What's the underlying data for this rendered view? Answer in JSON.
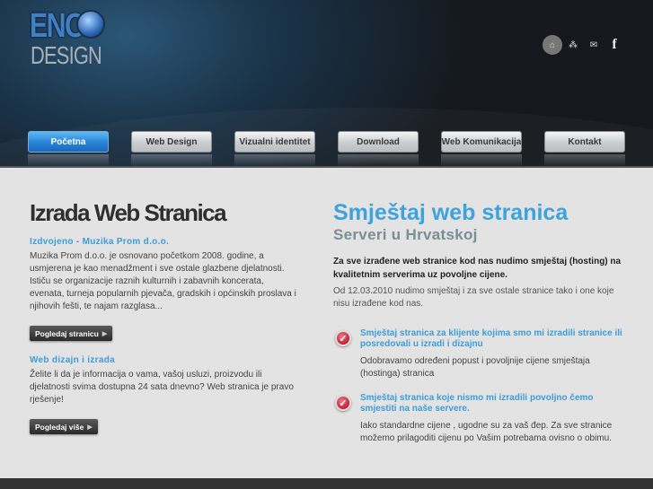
{
  "logo": {
    "line1": "ENO",
    "line2": "DESIGN"
  },
  "top_icons": [
    {
      "name": "home-icon",
      "glyph": "⌂"
    },
    {
      "name": "sitemap-icon",
      "glyph": "⁂"
    },
    {
      "name": "mail-icon",
      "glyph": "✉"
    },
    {
      "name": "facebook-icon",
      "glyph": "f"
    }
  ],
  "nav": [
    "Početna",
    "Web Design",
    "Vizualni identitet",
    "Download",
    "Web Komunikacija",
    "Kontakt"
  ],
  "left": {
    "title": "Izrada Web Stranica",
    "s1_title": "Izdvojeno - Muzika Prom d.o.o.",
    "s1_text": "Muzika Prom d.o.o. je osnovano početkom 2008. godine, a usmjerena je kao menadžment i sve ostale glazbene djelatnosti. Ističu se organizacije raznih kulturnih i zabavnih koncerata, evenata, turneja popularnih pjevača, gradskih i općinskih proslava i njihovih fešti, te najam razglasa...",
    "s1_button": "Pogledaj stranicu",
    "s2_title": "Web dizajn i izrada",
    "s2_text": "Želite li da je informacija o vama, vašoj usluzi, proizvodu ili djelatnosti svima dostupna 24 sata dnevno? Web stranica je pravo rješenje!",
    "s2_button": "Pogledaj više"
  },
  "right": {
    "title": "Smještaj web stranica",
    "subtitle": "Serveri u Hrvatskoj",
    "intro_bold": "Za sve izrađene web stranice kod nas nudimo smještaj (hosting) na kvalitetnim serverima uz povoljne cijene.",
    "intro": "Od 12.03.2010 nudimo smještaj i za sve ostale stranice tako i one koje nisu izrađene kod nas.",
    "items": [
      {
        "title": "Smještaj stranica za klijente kojima smo mi izradili stranice ili posredovali u izradi i dizajnu",
        "text": "Odobravamo određeni popust i povoljnije cijene smještaja (hostinga) stranica"
      },
      {
        "title": "Smještaj stranica koje nismo mi izradili povoljno čemo smjestiti na naše servere.",
        "text": "Iako standardne cijene , ugodne su za vaš đep. Za sve stranice možemo prilagoditi cijenu po Vašim potrebama ovisno o obimu."
      }
    ]
  }
}
